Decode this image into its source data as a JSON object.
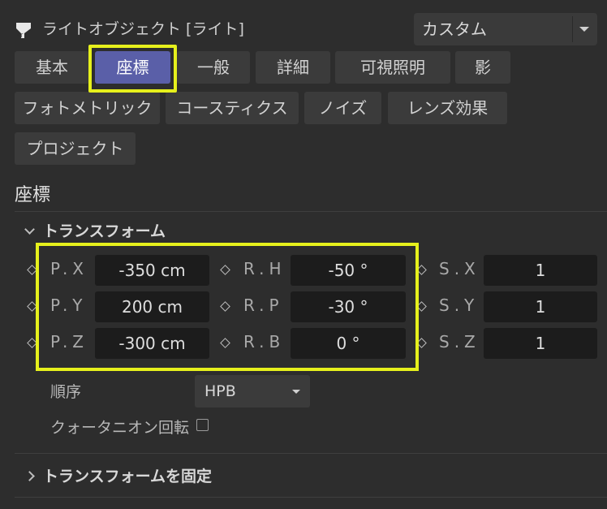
{
  "header": {
    "title": "ライトオブジェクト [ライト]",
    "mode_value": "カスタム"
  },
  "tabs": [
    "基本",
    "座標",
    "一般",
    "詳細",
    "可視照明",
    "影",
    "フォトメトリック",
    "コースティクス",
    "ノイズ",
    "レンズ効果",
    "プロジェクト"
  ],
  "active_tab": "座標",
  "section": {
    "title": "座標"
  },
  "transform": {
    "group_title": "トランスフォーム",
    "position": [
      {
        "label": "P.X",
        "value": "-350 cm"
      },
      {
        "label": "P.Y",
        "value": "200 cm"
      },
      {
        "label": "P.Z",
        "value": "-300 cm"
      }
    ],
    "rotation": [
      {
        "label": "R.H",
        "value": "-50 °"
      },
      {
        "label": "R.P",
        "value": "-30 °"
      },
      {
        "label": "R.B",
        "value": "0 °"
      }
    ],
    "scale": [
      {
        "label": "S.X",
        "value": "1"
      },
      {
        "label": "S.Y",
        "value": "1"
      },
      {
        "label": "S.Z",
        "value": "1"
      }
    ],
    "order_label": "順序",
    "order_value": "HPB",
    "quaternion_label": "クォータニオン回転",
    "quaternion_checked": false
  },
  "freeze": {
    "group_title": "トランスフォームを固定"
  },
  "colors": {
    "active_tab": "#5a5fa8",
    "highlight": "#e6f01c",
    "background": "#2d2d2d"
  }
}
